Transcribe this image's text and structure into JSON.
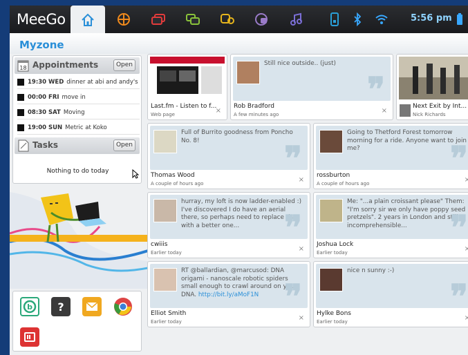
{
  "topbar": {
    "brand": "MeeGo",
    "clock": "5:56 pm",
    "tabs": [
      {
        "icon": "home-icon",
        "color": "#2a8fd8"
      },
      {
        "icon": "applications-icon",
        "color": "#f08a1c"
      },
      {
        "icon": "tasks-icon",
        "color": "#e23b3b"
      },
      {
        "icon": "people-icon",
        "color": "#8ac23a"
      },
      {
        "icon": "status-icon",
        "color": "#e7b51c"
      },
      {
        "icon": "pasteboard-icon",
        "color": "#9a7bc9"
      },
      {
        "icon": "music-icon",
        "color": "#7b6fd6"
      },
      {
        "icon": "device-icon",
        "color": "#2a9fd8"
      },
      {
        "icon": "bluetooth-icon",
        "color": "#38a8ff"
      },
      {
        "icon": "wifi-icon",
        "color": "#38a8ff"
      },
      {
        "icon": "battery-icon",
        "color": "#38a8ff"
      }
    ]
  },
  "zone": {
    "title": "Myzone"
  },
  "appointments": {
    "title": "Appointments",
    "calendar_day": "18",
    "open_label": "Open",
    "items": [
      {
        "time": "19:30 WED",
        "text": "dinner at abi and andy's"
      },
      {
        "time": "00:00 FRI",
        "text": "move in"
      },
      {
        "time": "08:30 SAT",
        "text": "Moving"
      },
      {
        "time": "19:00 SUN",
        "text": "Metric at Koko"
      }
    ]
  },
  "tasks": {
    "title": "Tasks",
    "open_label": "Open",
    "empty": "Nothing to do today"
  },
  "launcher": {
    "apps": [
      {
        "icon": "browser-b-icon",
        "color": "#2aa87a"
      },
      {
        "icon": "help-icon",
        "color": "#444"
      },
      {
        "icon": "email-icon",
        "color": "#f0a820"
      },
      {
        "icon": "chrome-icon",
        "color": "#d44"
      },
      {
        "icon": "media-icon",
        "color": "#d33"
      }
    ]
  },
  "web_cards": [
    {
      "title": "Last.fm - Listen to f...",
      "sub": "Web page",
      "close": "×"
    },
    {
      "title": "Next Exit by Int...",
      "sub": "Nick Richards"
    }
  ],
  "feed": [
    {
      "text": "Still nice outside.. (just)",
      "name": "Rob Bradford",
      "time": "A few minutes ago",
      "close": "×"
    },
    {
      "text": "Full of Burrito goodness from Poncho No. 8!",
      "name": "Thomas Wood",
      "time": "A couple of hours ago",
      "close": "×"
    },
    {
      "text": "Going to Thetford Forest tomorrow morning for a ride. Anyone want to join me?",
      "name": "rossburton",
      "time": "A couple of hours ago",
      "close": "×"
    },
    {
      "text": "hurray, my loft is now ladder-enabled :) I've discovered I do have an aerial there, so perhaps need to replace that with a better one...",
      "name": "cwiiis",
      "time": "Earlier today",
      "close": "×"
    },
    {
      "text": "Me: \"...a plain croissant please\" Them: \"I'm sorry sir we only have poppy seed pretzels\". 2 years in London and still incomprehensible...",
      "name": "Joshua Lock",
      "time": "Earlier today",
      "close": "×"
    },
    {
      "text": "RT @ballardian, @marcusod: DNA origami - nanoscale robotic spiders small enough to crawl around on your DNA.",
      "link": "http://bit.ly/aMoF1N",
      "name": "Elliot Smith",
      "time": "Earlier today",
      "close": "×"
    },
    {
      "text": "nice n sunny :-)",
      "name": "Hylke Bons",
      "time": "Earlier today",
      "close": "×"
    }
  ]
}
